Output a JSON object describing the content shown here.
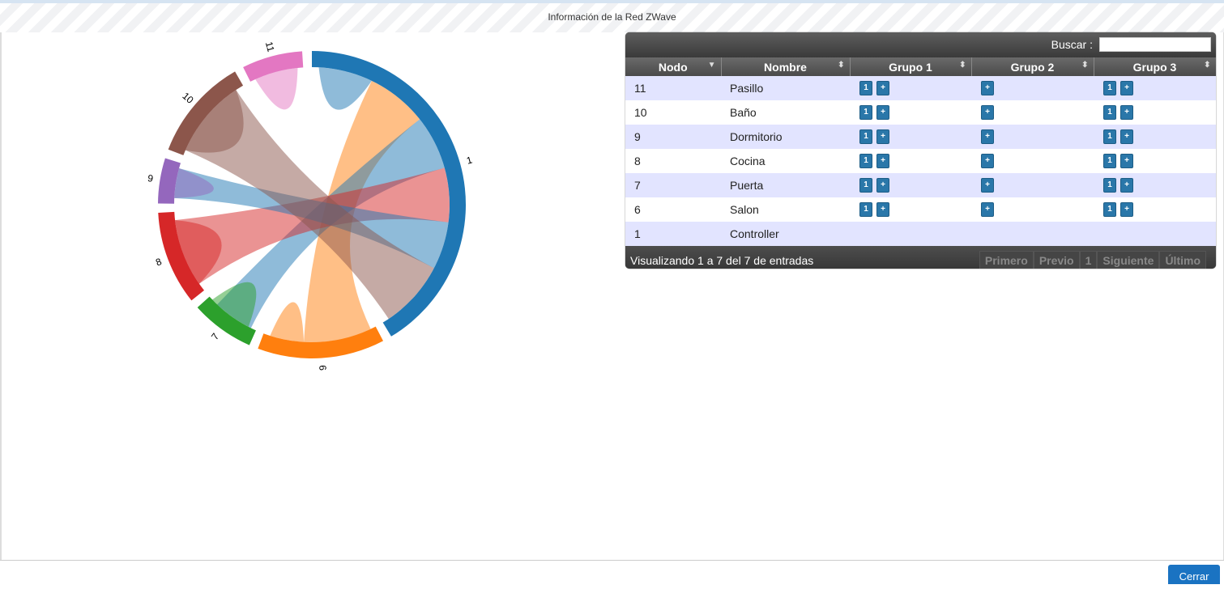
{
  "dialog": {
    "title": "Información de la Red ZWave",
    "close_label": "Cerrar"
  },
  "chord": {
    "groups": [
      {
        "label": "1",
        "color": "#1f77b4",
        "start": 0.0,
        "end": 2.6
      },
      {
        "label": "6",
        "color": "#ff7f0e",
        "start": 2.66,
        "end": 3.5
      },
      {
        "label": "7",
        "color": "#2ca02c",
        "start": 3.56,
        "end": 3.98
      },
      {
        "label": "8",
        "color": "#d62728",
        "start": 4.04,
        "end": 4.66
      },
      {
        "label": "9",
        "color": "#9467bd",
        "start": 4.72,
        "end": 5.02
      },
      {
        "label": "10",
        "color": "#8c564b",
        "start": 5.08,
        "end": 5.76
      },
      {
        "label": "11",
        "color": "#e377c2",
        "start": 5.82,
        "end": 6.22
      }
    ],
    "chords": [
      {
        "color": "#1f77b4",
        "s": [
          0.05,
          0.45
        ],
        "t": [
          0.05,
          0.45
        ]
      },
      {
        "color": "#ff7f0e",
        "s": [
          0.45,
          0.9
        ],
        "t": [
          2.7,
          3.2
        ]
      },
      {
        "color": "#1f77b4",
        "s": [
          0.9,
          1.3
        ],
        "t": [
          3.6,
          3.9
        ]
      },
      {
        "color": "#d62728",
        "s": [
          1.3,
          1.7
        ],
        "t": [
          4.1,
          4.6
        ]
      },
      {
        "color": "#1f77b4",
        "s": [
          1.7,
          2.05
        ],
        "t": [
          4.76,
          4.98
        ]
      },
      {
        "color": "#8c564b",
        "s": [
          2.05,
          2.55
        ],
        "t": [
          5.12,
          5.7
        ]
      },
      {
        "color": "#ff7f0e",
        "s": [
          3.2,
          3.45
        ],
        "t": [
          3.2,
          3.45
        ]
      },
      {
        "color": "#2ca02c",
        "s": [
          3.62,
          3.95
        ],
        "t": [
          3.62,
          3.95
        ]
      },
      {
        "color": "#d62728",
        "s": [
          4.1,
          4.6
        ],
        "t": [
          4.1,
          4.6
        ]
      },
      {
        "color": "#9467bd",
        "s": [
          4.76,
          4.98
        ],
        "t": [
          4.76,
          4.98
        ]
      },
      {
        "color": "#8c564b",
        "s": [
          5.12,
          5.7
        ],
        "t": [
          5.12,
          5.7
        ]
      },
      {
        "color": "#e377c2",
        "s": [
          5.86,
          6.18
        ],
        "t": [
          5.86,
          6.18
        ]
      }
    ]
  },
  "table": {
    "search_label": "Buscar :",
    "columns": [
      "Nodo",
      "Nombre",
      "Grupo 1",
      "Grupo 2",
      "Grupo 3"
    ],
    "rows": [
      {
        "nodo": "11",
        "nombre": "Pasillo",
        "g1": true,
        "g2": false,
        "g3": true
      },
      {
        "nodo": "10",
        "nombre": "Baño",
        "g1": true,
        "g2": false,
        "g3": true
      },
      {
        "nodo": "9",
        "nombre": "Dormitorio",
        "g1": true,
        "g2": false,
        "g3": true
      },
      {
        "nodo": "8",
        "nombre": "Cocina",
        "g1": true,
        "g2": false,
        "g3": true
      },
      {
        "nodo": "7",
        "nombre": "Puerta",
        "g1": true,
        "g2": false,
        "g3": true
      },
      {
        "nodo": "6",
        "nombre": "Salon",
        "g1": true,
        "g2": false,
        "g3": true
      },
      {
        "nodo": "1",
        "nombre": "Controller",
        "g1": null,
        "g2": null,
        "g3": null
      }
    ],
    "button_one": "1",
    "button_plus": "+",
    "info": "Visualizando 1 a 7 del 7 de entradas",
    "pager": [
      "Primero",
      "Previo",
      "1",
      "Siguiente",
      "Último"
    ]
  }
}
